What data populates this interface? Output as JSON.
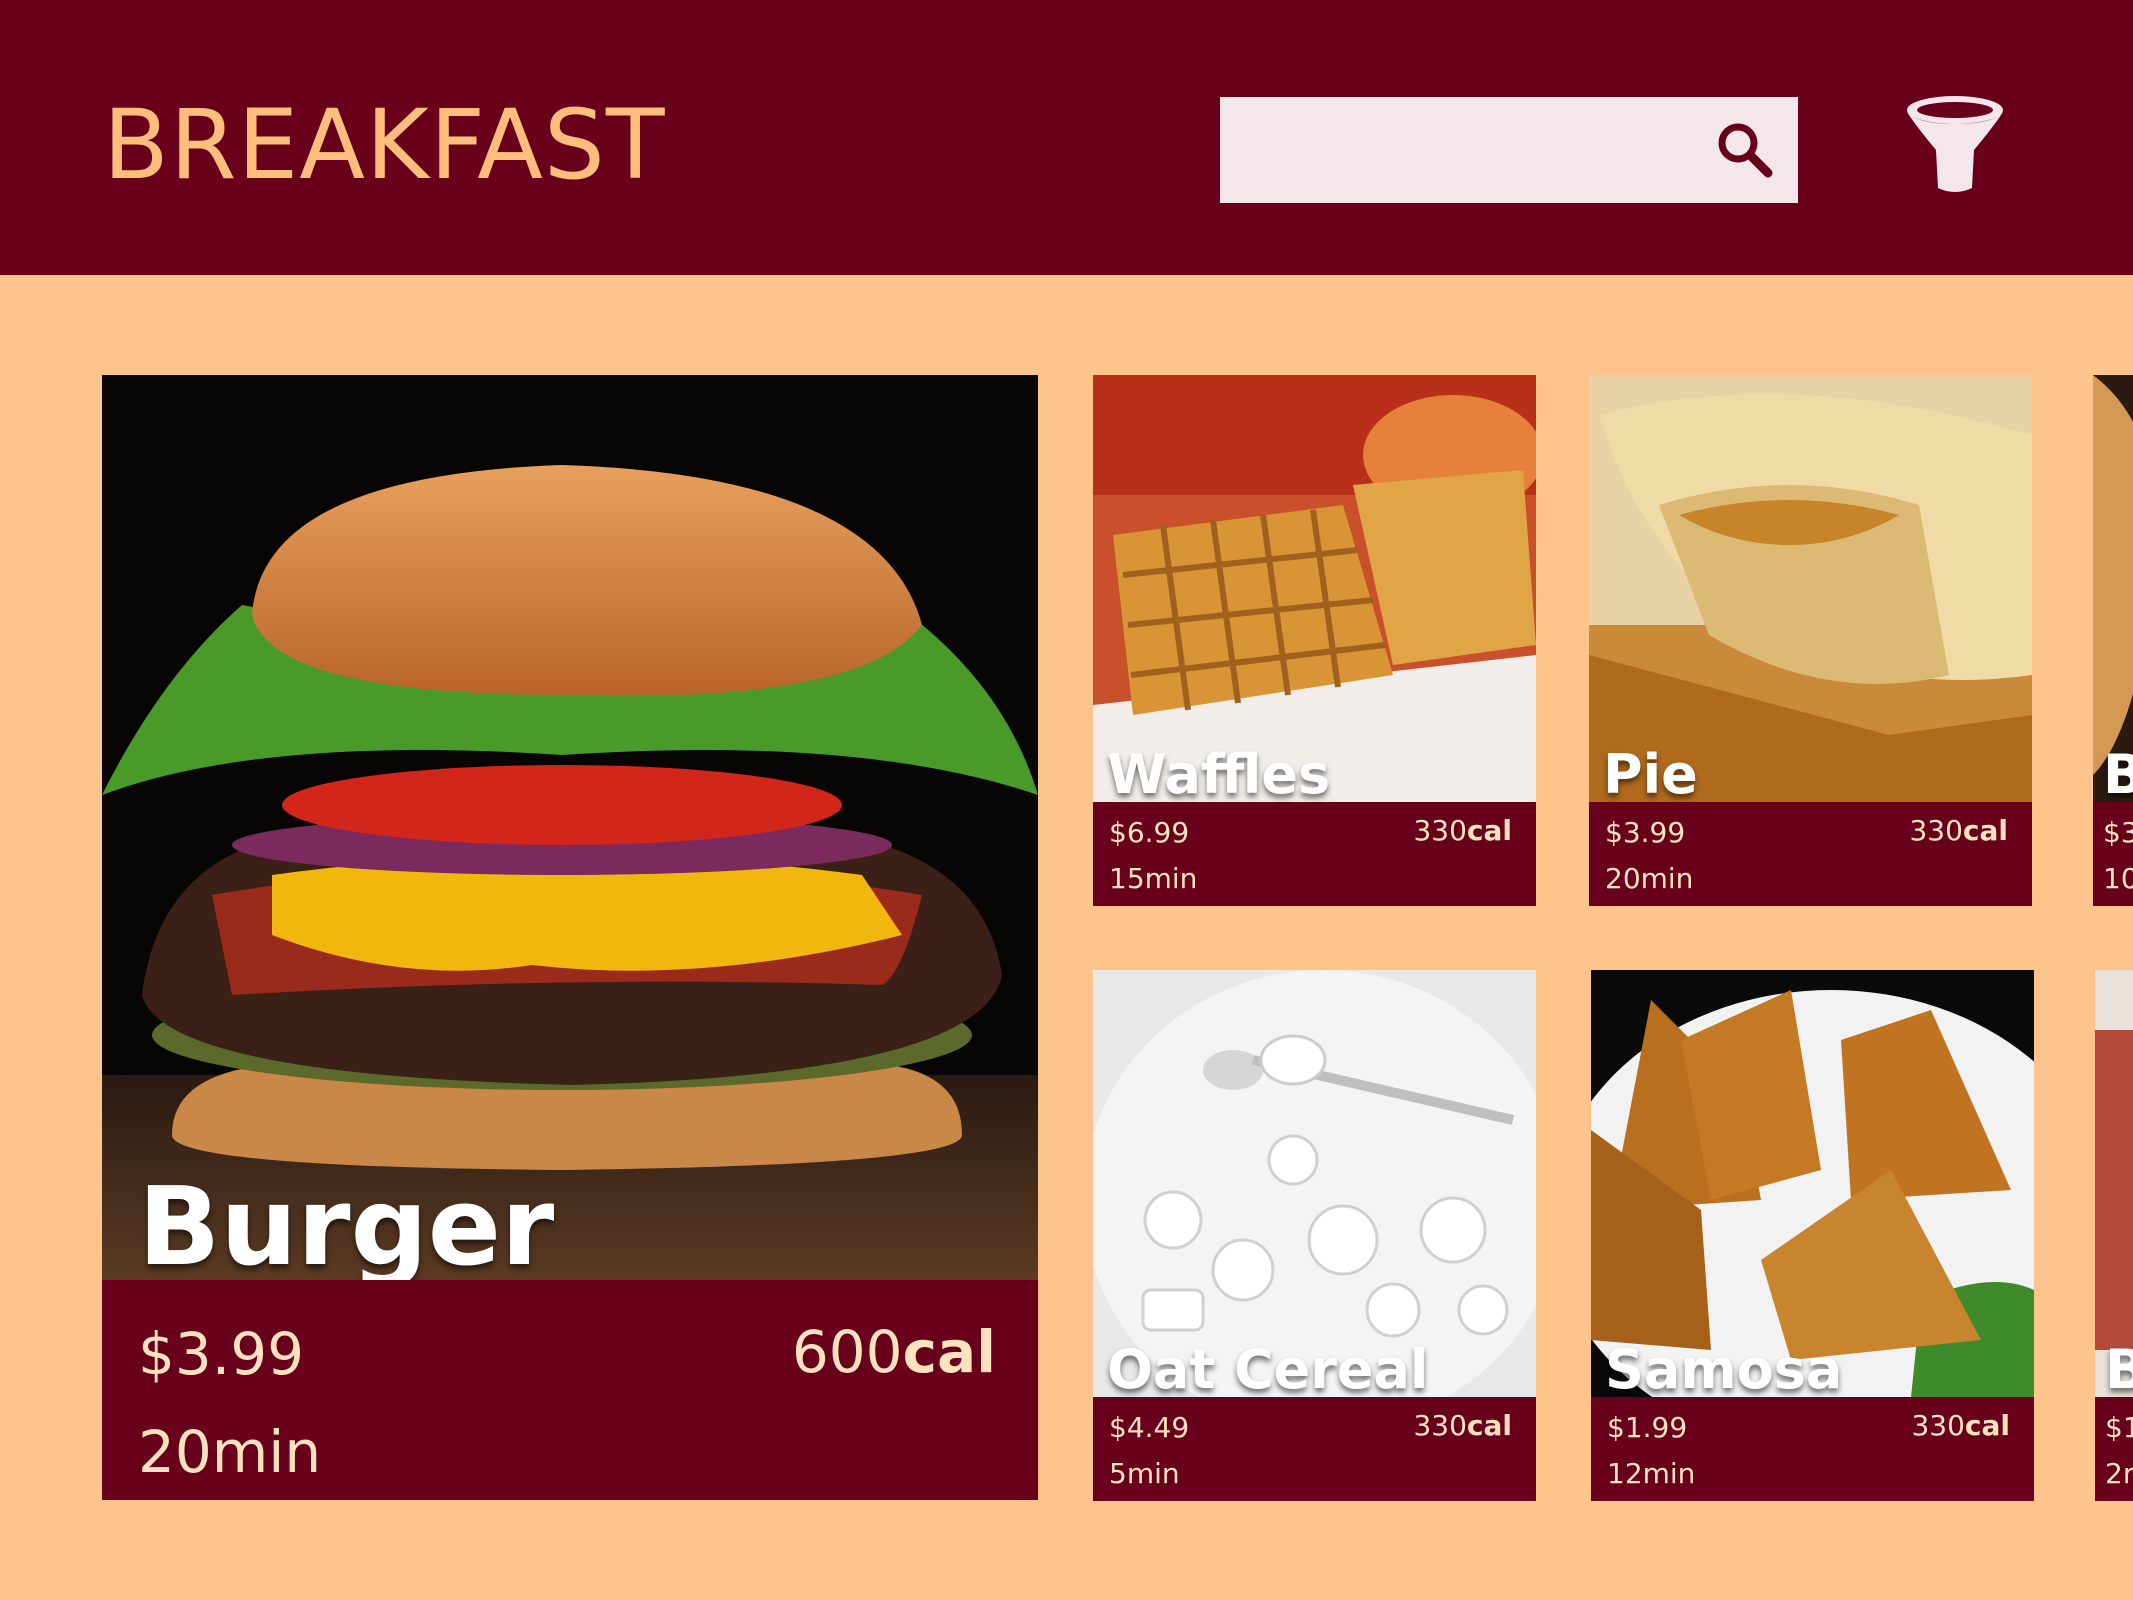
{
  "header": {
    "title": "BREAKFAST",
    "search": {
      "value": "",
      "placeholder": ""
    },
    "icons": [
      "search-icon",
      "filter-icon"
    ]
  },
  "featured": {
    "name": "Burger",
    "price": "$3.99",
    "calories": "600",
    "calories_unit": "cal",
    "time": "20min"
  },
  "tiles": [
    {
      "name": "Waffles",
      "price": "$6.99",
      "calories": "330",
      "calories_unit": "cal",
      "time": "15min"
    },
    {
      "name": "Pie",
      "price": "$3.99",
      "calories": "330",
      "calories_unit": "cal",
      "time": "20min"
    },
    {
      "name": "Oat Cereal",
      "price": "$4.49",
      "calories": "330",
      "calories_unit": "cal",
      "time": "5min"
    },
    {
      "name": "Samosa",
      "price": "$1.99",
      "calories": "330",
      "calories_unit": "cal",
      "time": "12min"
    }
  ],
  "edge_tiles": [
    {
      "name": "B",
      "price": "$3",
      "time": "10"
    },
    {
      "name": "B",
      "price": "$1",
      "time": "2r"
    }
  ],
  "colors": {
    "header": "#68001C",
    "background": "#FFC48C",
    "title": "#FFBE7C",
    "search_box": "#F3E7EC"
  }
}
